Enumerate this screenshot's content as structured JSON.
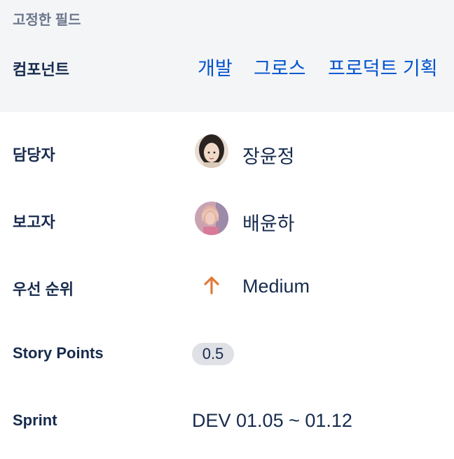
{
  "pinned": {
    "title": "고정한 필드",
    "components_label": "컴포넌트",
    "components": [
      "개발",
      "그로스",
      "프로덕트 기획"
    ]
  },
  "fields": {
    "assignee": {
      "label": "담당자",
      "value": "장윤정"
    },
    "reporter": {
      "label": "보고자",
      "value": "배윤하"
    },
    "priority": {
      "label": "우선 순위",
      "value": "Medium",
      "icon": "arrow-up-icon",
      "color": "#e07b39"
    },
    "story_points": {
      "label": "Story Points",
      "value": "0.5"
    },
    "sprint": {
      "label": "Sprint",
      "value": "DEV 01.05 ~ 01.12"
    }
  },
  "colors": {
    "pinned_bg": "#f4f5f7",
    "link": "#0052cc",
    "text": "#172b4d",
    "muted": "#6b778c"
  }
}
